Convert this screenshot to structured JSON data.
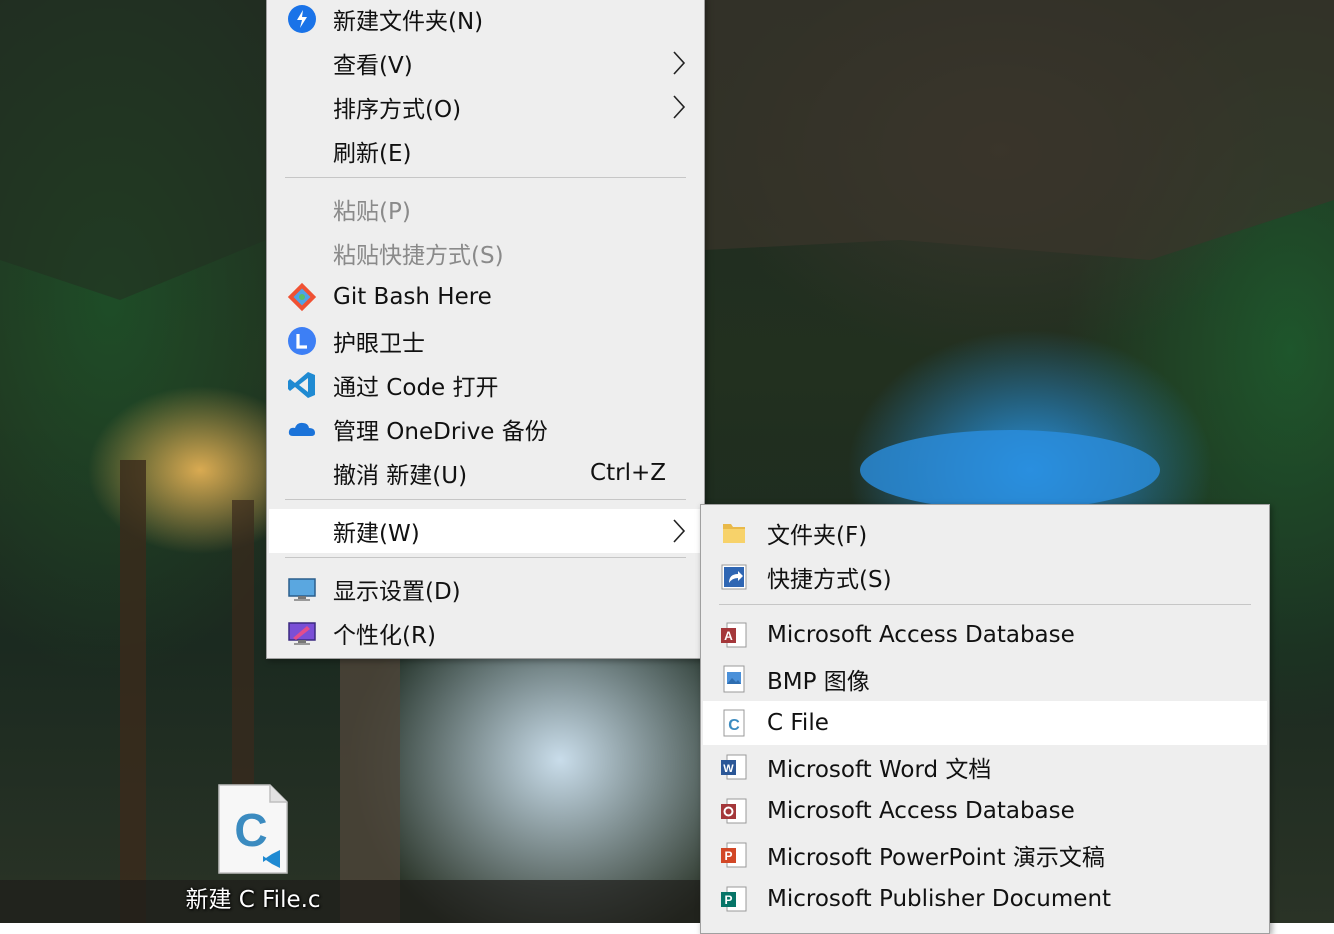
{
  "context_menu": {
    "items": [
      {
        "label": "新建文件夹(N)",
        "icon": "new-folder-icon"
      },
      {
        "label": "查看(V)",
        "submenu": true
      },
      {
        "label": "排序方式(O)",
        "submenu": true
      },
      {
        "label": "刷新(E)"
      },
      {
        "label": "粘贴(P)",
        "disabled": true
      },
      {
        "label": "粘贴快捷方式(S)",
        "disabled": true
      },
      {
        "label": "Git Bash Here",
        "icon": "git-bash-icon"
      },
      {
        "label": "护眼卫士",
        "icon": "eye-guard-icon"
      },
      {
        "label": "通过 Code 打开",
        "icon": "vscode-icon"
      },
      {
        "label": "管理 OneDrive 备份",
        "icon": "onedrive-icon"
      },
      {
        "label": "撤消 新建(U)",
        "shortcut": "Ctrl+Z"
      },
      {
        "label": "新建(W)",
        "submenu": true,
        "hover": true
      },
      {
        "label": "显示设置(D)",
        "icon": "display-settings-icon"
      },
      {
        "label": "个性化(R)",
        "icon": "personalize-icon"
      }
    ]
  },
  "new_submenu": {
    "items": [
      {
        "label": "文件夹(F)",
        "icon": "folder-icon"
      },
      {
        "label": "快捷方式(S)",
        "icon": "shortcut-icon"
      },
      {
        "label": "Microsoft Access Database",
        "icon": "access-icon"
      },
      {
        "label": "BMP 图像",
        "icon": "bmp-image-icon"
      },
      {
        "label": "C File",
        "icon": "c-file-icon",
        "hover": true
      },
      {
        "label": "Microsoft Word 文档",
        "icon": "word-icon"
      },
      {
        "label": "Microsoft Access Database",
        "icon": "access-icon"
      },
      {
        "label": "Microsoft PowerPoint 演示文稿",
        "icon": "powerpoint-icon"
      },
      {
        "label": "Microsoft Publisher Document",
        "icon": "publisher-icon"
      }
    ]
  },
  "desktop_icon": {
    "label": "新建 C File.c",
    "icon": "c-file-icon"
  },
  "colors": {
    "menu_bg": "#eeeeee",
    "hover_bg": "#ffffff",
    "disabled_text": "#8a8a8a",
    "separator": "#c6c6c6"
  }
}
